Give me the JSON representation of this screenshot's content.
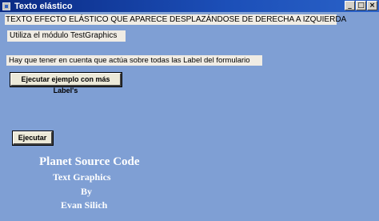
{
  "window": {
    "title": "Texto elástico",
    "icon": "app-window-icon",
    "buttons": {
      "minimize": "_",
      "maximize": "□",
      "close": "×"
    }
  },
  "labels": {
    "heading": "TEXTO EFECTO ELÁSTICO QUE APARECE DESPLAZÁNDOSE DE DERECHA A IZQUIERDA",
    "module": "Utiliza el módulo TestGraphics",
    "note": "Hay que tener en cuenta que actúa sobre todas las Label del formulario"
  },
  "buttons": {
    "example": "Ejecutar ejemplo con más Label's",
    "run": "Ejecutar"
  },
  "credits": {
    "line1": "Planet Source Code",
    "line2": "Text Graphics",
    "line3": "By",
    "line4": "Evan Silich"
  },
  "colors": {
    "form_background": "#7f9fd4",
    "label_background": "#f0ece4",
    "credit_text": "#ffffff"
  }
}
